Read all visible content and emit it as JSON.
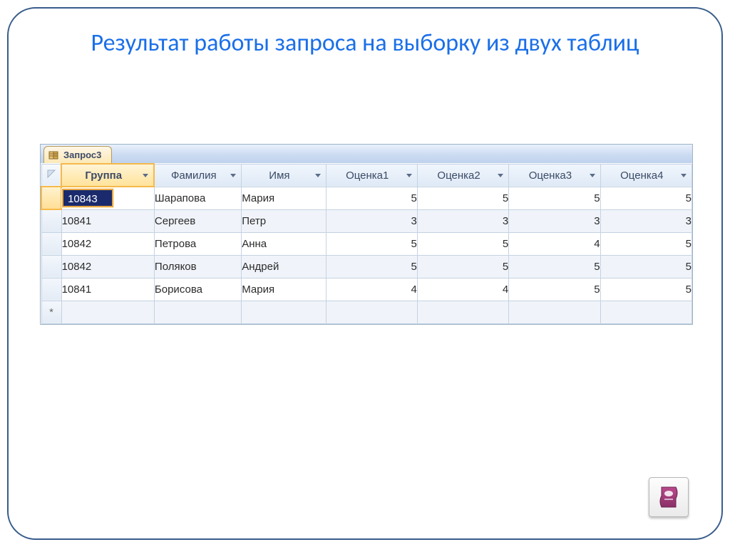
{
  "slide": {
    "title": "Результат работы запроса на выборку из двух таблиц"
  },
  "tab": {
    "label": "Запрос3"
  },
  "columns": {
    "group": "Группа",
    "surname": "Фамилия",
    "name": "Имя",
    "grade1": "Оценка1",
    "grade2": "Оценка2",
    "grade3": "Оценка3",
    "grade4": "Оценка4"
  },
  "rows": [
    {
      "group": "10843",
      "surname": "Шарапова",
      "name": "Мария",
      "g1": 5,
      "g2": 5,
      "g3": 5,
      "g4": 5
    },
    {
      "group": "10841",
      "surname": "Сергеев",
      "name": "Петр",
      "g1": 3,
      "g2": 3,
      "g3": 3,
      "g4": 3
    },
    {
      "group": "10842",
      "surname": "Петрова",
      "name": "Анна",
      "g1": 5,
      "g2": 5,
      "g3": 4,
      "g4": 5
    },
    {
      "group": "10842",
      "surname": "Поляков",
      "name": "Андрей",
      "g1": 5,
      "g2": 5,
      "g3": 5,
      "g4": 5
    },
    {
      "group": "10841",
      "surname": "Борисова",
      "name": "Мария",
      "g1": 4,
      "g2": 4,
      "g3": 5,
      "g4": 5
    }
  ],
  "new_row_marker": "*"
}
